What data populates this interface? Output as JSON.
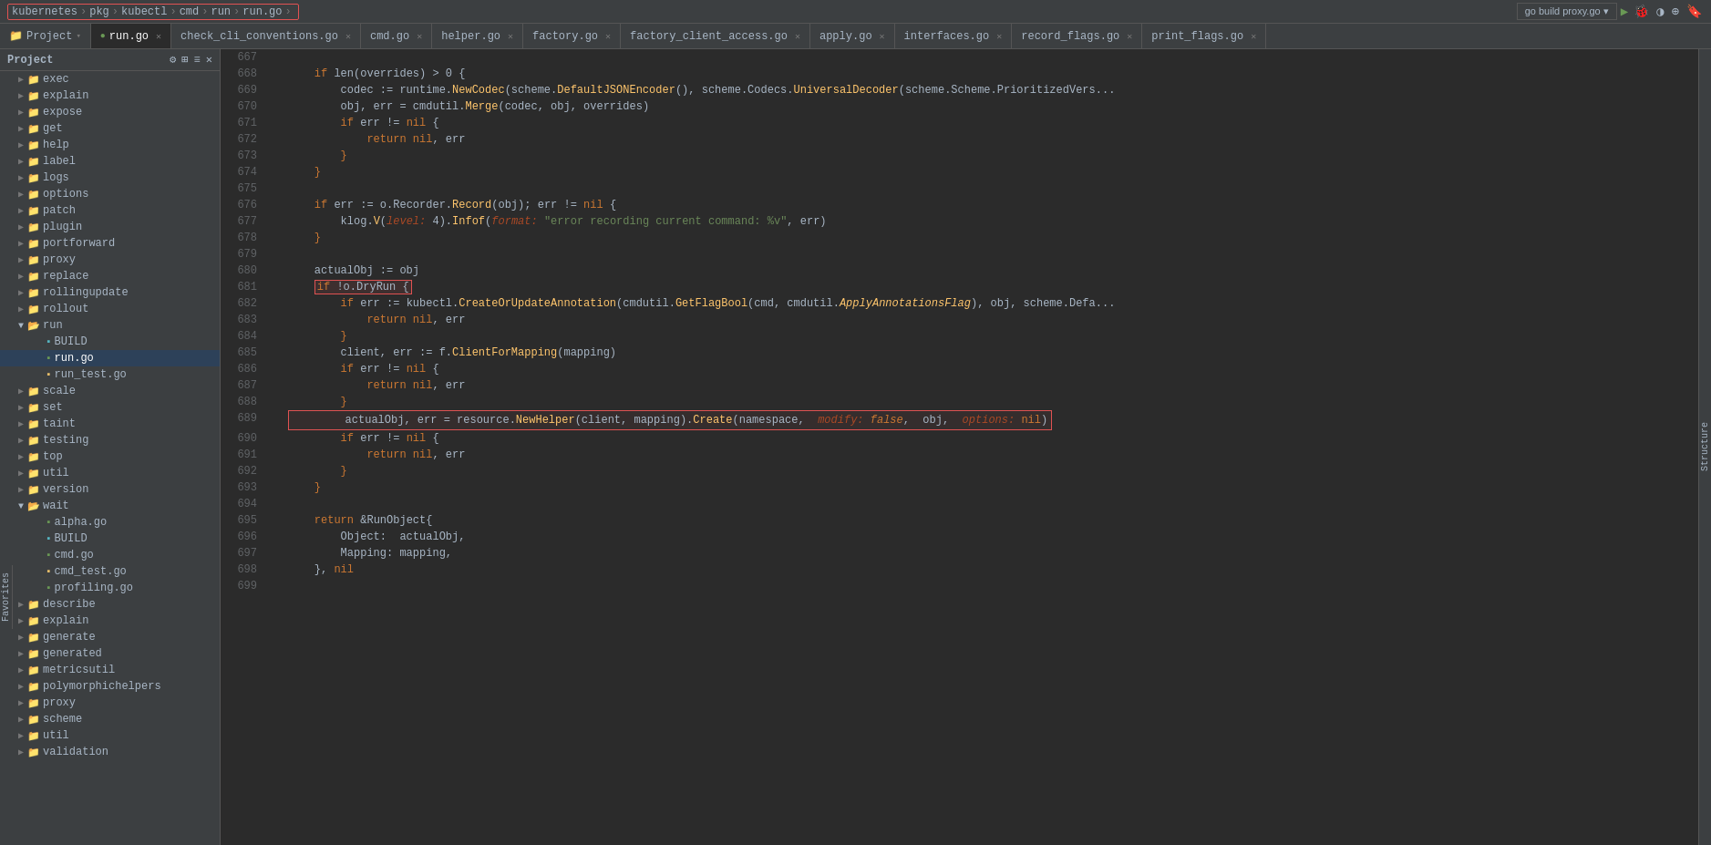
{
  "breadcrumb": {
    "items": [
      "kubernetes",
      "pkg",
      "kubectl",
      "cmd",
      "run",
      "run.go"
    ],
    "separators": [
      ">",
      ">",
      ">",
      ">",
      ">"
    ],
    "container_has_border": true
  },
  "toolbar": {
    "run_build_label": "go build proxy.go ▾",
    "run_icon": "▶",
    "debug_icon": "🐛",
    "coverage_icon": "◑",
    "profiler_icon": "⊕",
    "bookmark_icon": "🔖"
  },
  "tabs": [
    {
      "label": "run.go",
      "active": true,
      "modified": false
    },
    {
      "label": "check_cli_conventions.go",
      "active": false
    },
    {
      "label": "cmd.go",
      "active": false
    },
    {
      "label": "helper.go",
      "active": false
    },
    {
      "label": "factory.go",
      "active": false
    },
    {
      "label": "factory_client_access.go",
      "active": false
    },
    {
      "label": "apply.go",
      "active": false
    },
    {
      "label": "interfaces.go",
      "active": false
    },
    {
      "label": "record_flags.go",
      "active": false
    },
    {
      "label": "print_flags.go",
      "active": false
    }
  ],
  "sidebar": {
    "title": "Project",
    "items": [
      {
        "indent": 1,
        "type": "folder",
        "label": "exec",
        "open": false
      },
      {
        "indent": 1,
        "type": "folder",
        "label": "explain",
        "open": false
      },
      {
        "indent": 1,
        "type": "folder",
        "label": "expose",
        "open": false
      },
      {
        "indent": 1,
        "type": "folder",
        "label": "get",
        "open": false
      },
      {
        "indent": 1,
        "type": "folder",
        "label": "help",
        "open": false
      },
      {
        "indent": 1,
        "type": "folder",
        "label": "label",
        "open": false
      },
      {
        "indent": 1,
        "type": "folder",
        "label": "logs",
        "open": false
      },
      {
        "indent": 1,
        "type": "folder",
        "label": "options",
        "open": false
      },
      {
        "indent": 1,
        "type": "folder",
        "label": "patch",
        "open": false
      },
      {
        "indent": 1,
        "type": "folder",
        "label": "plugin",
        "open": false
      },
      {
        "indent": 1,
        "type": "folder",
        "label": "portforward",
        "open": false
      },
      {
        "indent": 1,
        "type": "folder",
        "label": "proxy",
        "open": false
      },
      {
        "indent": 1,
        "type": "folder",
        "label": "replace",
        "open": false
      },
      {
        "indent": 1,
        "type": "folder",
        "label": "rollingupdate",
        "open": false
      },
      {
        "indent": 1,
        "type": "folder",
        "label": "rollout",
        "open": false
      },
      {
        "indent": 1,
        "type": "folder",
        "label": "run",
        "open": true
      },
      {
        "indent": 2,
        "type": "file",
        "label": "BUILD",
        "open": false,
        "color": "cyan"
      },
      {
        "indent": 2,
        "type": "file",
        "label": "run.go",
        "open": false,
        "color": "green",
        "active": true
      },
      {
        "indent": 2,
        "type": "file",
        "label": "run_test.go",
        "open": false,
        "color": "test"
      },
      {
        "indent": 1,
        "type": "folder",
        "label": "scale",
        "open": false
      },
      {
        "indent": 1,
        "type": "folder",
        "label": "set",
        "open": false
      },
      {
        "indent": 1,
        "type": "folder",
        "label": "taint",
        "open": false
      },
      {
        "indent": 1,
        "type": "folder",
        "label": "testing",
        "open": false
      },
      {
        "indent": 1,
        "type": "folder",
        "label": "top",
        "open": false
      },
      {
        "indent": 1,
        "type": "folder",
        "label": "util",
        "open": false
      },
      {
        "indent": 1,
        "type": "folder",
        "label": "version",
        "open": false
      },
      {
        "indent": 1,
        "type": "folder",
        "label": "wait",
        "open": false
      },
      {
        "indent": 2,
        "type": "file",
        "label": "alpha.go",
        "color": "green"
      },
      {
        "indent": 2,
        "type": "file",
        "label": "BUILD",
        "color": "cyan"
      },
      {
        "indent": 2,
        "type": "file",
        "label": "cmd.go",
        "color": "green"
      },
      {
        "indent": 2,
        "type": "file",
        "label": "cmd_test.go",
        "color": "test"
      },
      {
        "indent": 2,
        "type": "file",
        "label": "profiling.go",
        "color": "green"
      },
      {
        "indent": 1,
        "type": "folder",
        "label": "describe",
        "open": false
      },
      {
        "indent": 1,
        "type": "folder",
        "label": "explain",
        "open": false
      },
      {
        "indent": 1,
        "type": "folder",
        "label": "generate",
        "open": false
      },
      {
        "indent": 1,
        "type": "folder",
        "label": "generated",
        "open": false
      },
      {
        "indent": 1,
        "type": "folder",
        "label": "metricsutil",
        "open": false
      },
      {
        "indent": 1,
        "type": "folder",
        "label": "polymorphichelpers",
        "open": false
      },
      {
        "indent": 1,
        "type": "folder",
        "label": "proxy",
        "open": false
      },
      {
        "indent": 1,
        "type": "folder",
        "label": "scheme",
        "open": false
      },
      {
        "indent": 1,
        "type": "folder",
        "label": "util",
        "open": false
      },
      {
        "indent": 1,
        "type": "folder",
        "label": "validation",
        "open": false
      }
    ]
  },
  "code": {
    "lines": [
      {
        "num": 667,
        "content": ""
      },
      {
        "num": 668,
        "content": "\tif len(overrides) > 0 {",
        "tokens": [
          {
            "text": "\t",
            "class": ""
          },
          {
            "text": "if",
            "class": "kw"
          },
          {
            "text": " len(overrides) > 0 {",
            "class": ""
          }
        ]
      },
      {
        "num": 669,
        "content": "\t\tcodec := runtime.NewCodec(scheme.DefaultJSONEncoder(), scheme.Codecs.UniversalDecoder(scheme.Scheme.PrioritizedVers..."
      },
      {
        "num": 670,
        "content": "\t\tobj, err = cmdutil.Merge(codec, obj, overrides)"
      },
      {
        "num": 671,
        "content": "\t\tif err != nil {"
      },
      {
        "num": 672,
        "content": "\t\t\treturn nil, err"
      },
      {
        "num": 673,
        "content": "\t\t}"
      },
      {
        "num": 674,
        "content": "\t}"
      },
      {
        "num": 675,
        "content": ""
      },
      {
        "num": 676,
        "content": "\tif err := o.Recorder.Record(obj); err != nil {"
      },
      {
        "num": 677,
        "content": "\t\tklog.V(level: 4).Infof(format: \"error recording current command: %v\", err)"
      },
      {
        "num": 678,
        "content": "\t}"
      },
      {
        "num": 679,
        "content": ""
      },
      {
        "num": 680,
        "content": "\tactualObj := obj"
      },
      {
        "num": 681,
        "content": "\tif !o.DryRun {",
        "red_border": true
      },
      {
        "num": 682,
        "content": "\t\tif err := kubectl.CreateOrUpdateAnnotation(cmdutil.GetFlagBool(cmd, cmdutil.ApplyAnnotationsFlag), obj, scheme.Defa..."
      },
      {
        "num": 683,
        "content": "\t\t\treturn nil, err"
      },
      {
        "num": 684,
        "content": "\t\t}"
      },
      {
        "num": 685,
        "content": "\t\tclient, err := f.ClientForMapping(mapping)"
      },
      {
        "num": 686,
        "content": "\t\tif err != nil {"
      },
      {
        "num": 687,
        "content": "\t\t\treturn nil, err"
      },
      {
        "num": 688,
        "content": "\t\t}"
      },
      {
        "num": 689,
        "content": "\t\tactualObj, err = resource.NewHelper(client, mapping).Create(namespace,  modify: false,  obj,  options: nil)",
        "red_border": true
      },
      {
        "num": 690,
        "content": "\t\tif err != nil {"
      },
      {
        "num": 691,
        "content": "\t\t\treturn nil, err"
      },
      {
        "num": 692,
        "content": "\t\t}"
      },
      {
        "num": 693,
        "content": "\t}"
      },
      {
        "num": 694,
        "content": ""
      },
      {
        "num": 695,
        "content": "\treturn &RunObject{"
      },
      {
        "num": 696,
        "content": "\t\tObject:  actualObj,"
      },
      {
        "num": 697,
        "content": "\t\tMapping: mapping,"
      },
      {
        "num": 698,
        "content": "\t}, nil"
      },
      {
        "num": 699,
        "content": ""
      }
    ]
  },
  "structure_panel": {
    "label": "Structure"
  },
  "favorites_panel": {
    "label": "Favorites"
  }
}
